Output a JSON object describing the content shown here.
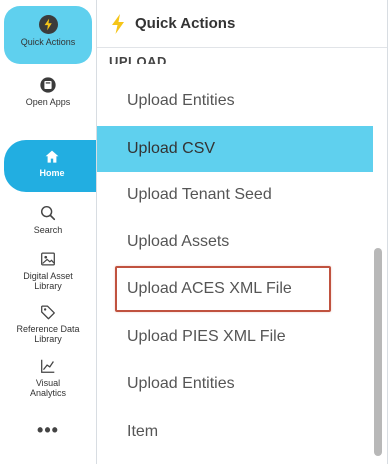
{
  "sidebar": {
    "items": [
      {
        "label": "Quick Actions",
        "icon": "bolt-icon"
      },
      {
        "label": "Open Apps",
        "icon": "open-apps-icon"
      },
      {
        "label": "Home",
        "icon": "home-icon"
      },
      {
        "label": "Search",
        "icon": "search-icon"
      },
      {
        "label": "Digital Asset Library",
        "icon": "image-icon"
      },
      {
        "label": "Reference Data Library",
        "icon": "tag-icon"
      },
      {
        "label": "Visual Analytics",
        "icon": "chart-icon"
      }
    ],
    "more": "•••"
  },
  "panel": {
    "title": "Quick Actions",
    "section": "UPLOAD",
    "items": [
      {
        "label": "Upload Entities"
      },
      {
        "label": "Upload CSV",
        "state": "active"
      },
      {
        "label": "Upload Tenant Seed"
      },
      {
        "label": "Upload Assets"
      },
      {
        "label": "Upload ACES XML File",
        "state": "highlighted"
      },
      {
        "label": "Upload PIES XML File"
      },
      {
        "label": "Upload Entities"
      },
      {
        "label": "Item"
      }
    ]
  },
  "colors": {
    "active_bg": "#5fd0ee",
    "home_bg": "#22aee1",
    "highlight_border": "#c0523f",
    "bolt": "#f5c518"
  }
}
